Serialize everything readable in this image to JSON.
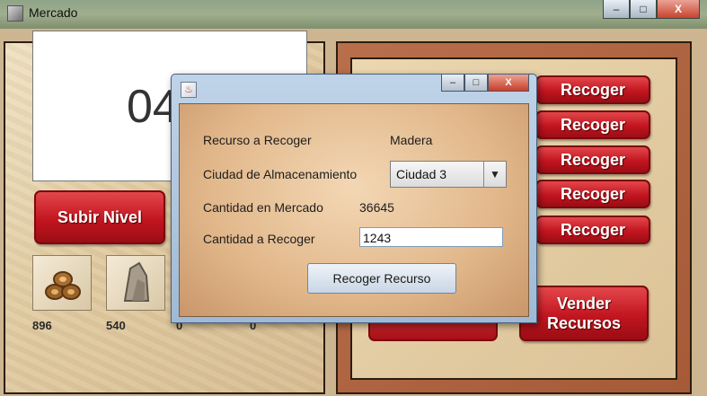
{
  "window": {
    "title": "Mercado",
    "icon": "app-icon",
    "caption_buttons": {
      "minimize": "–",
      "maximize": "□",
      "close": "X"
    }
  },
  "left_panel": {
    "display_value": "04",
    "subir_nivel_label": "Subir Nivel",
    "resources": [
      {
        "icon": "wood-logs-icon",
        "count": "896"
      },
      {
        "icon": "stone-icon",
        "count": "540"
      },
      {
        "icon": "resource-slot-icon",
        "count": "0"
      },
      {
        "icon": "resource-slot-icon",
        "count": "0"
      }
    ]
  },
  "right_panel": {
    "recoger_buttons": [
      "Recoger",
      "Recoger",
      "Recoger",
      "Recoger",
      "Recoger"
    ],
    "vender_label": [
      "Vender",
      "Recursos"
    ]
  },
  "dialog": {
    "icon": "java-icon",
    "caption_buttons": {
      "minimize": "–",
      "maximize": "□",
      "close": "X"
    },
    "recurso_label": "Recurso a Recoger",
    "recurso_value": "Madera",
    "ciudad_label": "Ciudad de Almacenamiento",
    "ciudad_value": "Ciudad 3",
    "cantidad_mercado_label": "Cantidad en Mercado",
    "cantidad_mercado_value": "36645",
    "cantidad_recoger_label": "Cantidad a Recoger",
    "cantidad_recoger_value": "1243",
    "submit_label": "Recoger Recurso"
  },
  "colors": {
    "button_red": "#c21520",
    "panel_parchment": "#e0cba2",
    "right_frame": "#a65a37"
  }
}
